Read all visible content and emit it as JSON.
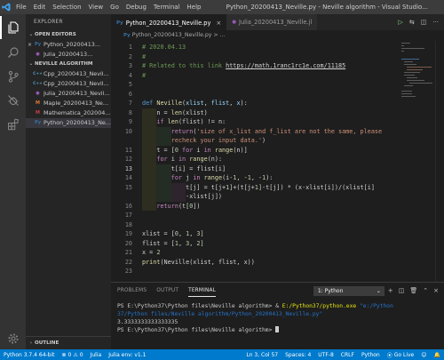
{
  "titlebar": {
    "menu": [
      "File",
      "Edit",
      "Selection",
      "View",
      "Go",
      "Debug",
      "Terminal",
      "Help"
    ],
    "title": "Python_20200413_Neville.py - Neville algorithm - Visual Studio..."
  },
  "sidebar": {
    "title": "EXPLORER",
    "open_editors_header": "OPEN EDITORS",
    "open_editors": [
      {
        "name": "Python_20200413...",
        "icon": "python-file-icon",
        "selected": false
      },
      {
        "name": "Julia_20200413...",
        "icon": "julia-file-icon",
        "selected": false
      }
    ],
    "folder_header": "NEVILLE ALGORITHM",
    "files": [
      {
        "name": "Cpp_20200413_Nevil...",
        "badge": "C++",
        "icon": "cpp-file-icon"
      },
      {
        "name": "Cpp_20200413_Nevil...",
        "badge": "C++",
        "icon": "cpp-file-icon"
      },
      {
        "name": "Julia_20200413_Nevill...",
        "badge": "●",
        "icon": "julia-file-icon"
      },
      {
        "name": "Maple_20200413_Nev...",
        "badge": "M",
        "icon": "maple-file-icon"
      },
      {
        "name": "Mathematica_202004...",
        "badge": "M",
        "icon": "mathematica-file-icon"
      },
      {
        "name": "Python_20200413_Ne...",
        "badge": "Py",
        "icon": "python-file-icon"
      }
    ],
    "outline_header": "OUTLINE"
  },
  "tabs": [
    {
      "label": "Python_20200413_Neville.py",
      "active": true
    },
    {
      "label": "Julia_20200413_Neville.jl",
      "active": false
    }
  ],
  "breadcrumb": "Python_20200413_Neville.py > ...",
  "code": {
    "current_line": 13,
    "lines": [
      [
        [
          "# 2020.04.13",
          "com"
        ]
      ],
      [
        [
          "#",
          "com"
        ]
      ],
      [
        [
          "# Related to this link ",
          "com"
        ],
        [
          "https://math.1ranc1rc1e.com/11185",
          "link"
        ]
      ],
      [
        [
          "#",
          "com"
        ]
      ],
      [],
      [],
      [
        [
          "def ",
          "kw"
        ],
        [
          "Neville",
          "fn"
        ],
        [
          "(",
          "p"
        ],
        [
          "xlist",
          "var"
        ],
        [
          ", ",
          "p"
        ],
        [
          "flist",
          "var"
        ],
        [
          ", ",
          "p"
        ],
        [
          "x",
          "var"
        ],
        [
          "):",
          "p"
        ]
      ],
      [
        [
          "    n = ",
          "p"
        ],
        [
          "len",
          "fn"
        ],
        [
          "(xlist)",
          "p"
        ]
      ],
      [
        [
          "    ",
          "p"
        ],
        [
          "if ",
          "ctl"
        ],
        [
          "len",
          "fn"
        ],
        [
          "(flist) != n:",
          "p"
        ]
      ],
      [
        [
          "        ",
          "p"
        ],
        [
          "return",
          "ctl"
        ],
        [
          "(",
          "p"
        ],
        [
          "'size of x_list and f_list are not the same, please",
          "str"
        ]
      ],
      [
        [
          "        recheck your input data.'",
          "str"
        ],
        [
          ")",
          "p"
        ]
      ],
      [
        [
          "    t = [",
          "p"
        ],
        [
          "0 ",
          "num"
        ],
        [
          "for ",
          "ctl"
        ],
        [
          "i ",
          "p"
        ],
        [
          "in ",
          "ctl"
        ],
        [
          "range",
          "fn"
        ],
        [
          "(n)]",
          "p"
        ]
      ],
      [
        [
          "    ",
          "p"
        ],
        [
          "for ",
          "ctl"
        ],
        [
          "i ",
          "p"
        ],
        [
          "in ",
          "ctl"
        ],
        [
          "range",
          "fn"
        ],
        [
          "(n):",
          "p"
        ]
      ],
      [
        [
          "        t[i] = flist[i]",
          "p"
        ]
      ],
      [
        [
          "        ",
          "p"
        ],
        [
          "for ",
          "ctl"
        ],
        [
          "j ",
          "p"
        ],
        [
          "in ",
          "ctl"
        ],
        [
          "range",
          "fn"
        ],
        [
          "(i-",
          "p"
        ],
        [
          "1",
          "num"
        ],
        [
          ", -",
          "p"
        ],
        [
          "1",
          "num"
        ],
        [
          ", -",
          "p"
        ],
        [
          "1",
          "num"
        ],
        [
          "):",
          "p"
        ]
      ],
      [
        [
          "            t[j] = t[j+",
          "p"
        ],
        [
          "1",
          "num"
        ],
        [
          "]+(t[j+",
          "p"
        ],
        [
          "1",
          "num"
        ],
        [
          "]-t[j]) * (x-xlist[i])/(xlist[i]",
          "p"
        ]
      ],
      [
        [
          "            -xlist[j])",
          "p"
        ]
      ],
      [
        [
          "    ",
          "p"
        ],
        [
          "return",
          "ctl"
        ],
        [
          "(t[",
          "p"
        ],
        [
          "0",
          "num"
        ],
        [
          "])",
          "p"
        ]
      ],
      [],
      [],
      [
        [
          "xlist = [",
          "p"
        ],
        [
          "0",
          "num"
        ],
        [
          ", ",
          "p"
        ],
        [
          "1",
          "num"
        ],
        [
          ", ",
          "p"
        ],
        [
          "3",
          "num"
        ],
        [
          "]",
          "p"
        ]
      ],
      [
        [
          "flist = [",
          "p"
        ],
        [
          "1",
          "num"
        ],
        [
          ", ",
          "p"
        ],
        [
          "3",
          "num"
        ],
        [
          ", ",
          "p"
        ],
        [
          "2",
          "num"
        ],
        [
          "]",
          "p"
        ]
      ],
      [
        [
          "x = ",
          "p"
        ],
        [
          "2",
          "num"
        ]
      ],
      [
        [
          "print",
          "fn"
        ],
        [
          "(Neville(xlist, flist, x))",
          "p"
        ]
      ],
      []
    ],
    "line_numbers": [
      "1",
      "2",
      "3",
      "4",
      "5",
      "6",
      "7",
      "8",
      "9",
      "10",
      "",
      "11",
      "12",
      "13",
      "14",
      "15",
      "",
      "16",
      "17",
      "18",
      "19",
      "20",
      "21",
      "22",
      "23"
    ]
  },
  "panel": {
    "tabs": [
      "PROBLEMS",
      "OUTPUT",
      "TERMINAL"
    ],
    "active_tab": "TERMINAL",
    "terminal_select": "1: Python",
    "terminal_lines": [
      [
        [
          "PS E:\\Python37\\Python files\\Neville algorithm> ",
          "plain"
        ],
        [
          "& ",
          "plain"
        ],
        [
          "E:/Python37/python.exe",
          "yel"
        ],
        [
          " \"e:/Python",
          "cmd"
        ]
      ],
      [
        [
          "37/Python files/Neville algorithm/Python_20200413_Neville.py\"",
          "cmd"
        ]
      ],
      [
        [
          "3.3333333333333335",
          "plain"
        ]
      ],
      [
        [
          "PS E:\\Python37\\Python files\\Neville algorithm> ",
          "plain"
        ],
        [
          "",
          "cursor"
        ]
      ]
    ]
  },
  "status": {
    "python": "Python 3.7.4 64-bit",
    "errors": "0",
    "warnings": "0",
    "julia": "Julia",
    "julia_env": "Julia env: v1.1",
    "position": "Ln 3, Col 57",
    "spaces": "Spaces: 4",
    "encoding": "UTF-8",
    "eol": "CRLF",
    "language": "Python",
    "golive": "Go Live"
  },
  "colors": {
    "statusbar": "#007acc",
    "activitybar": "#333333",
    "sidebar": "#252526",
    "editor": "#1e1e1e"
  }
}
